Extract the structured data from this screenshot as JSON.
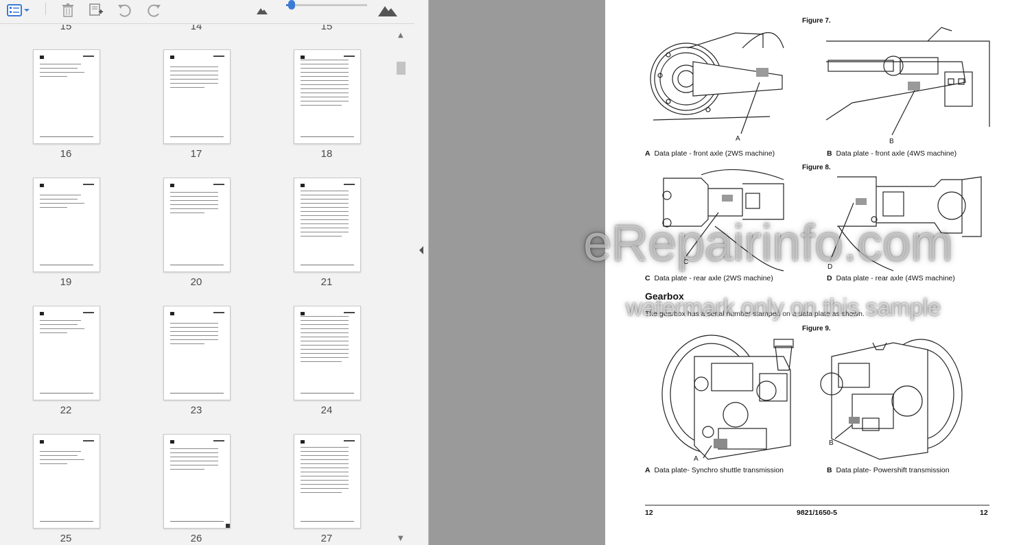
{
  "toolbar": {
    "view_icon": "thumbnail-view-icon",
    "dropdown_icon": "chevron-down-icon",
    "delete_icon": "trash-icon",
    "insert_icon": "insert-page-icon",
    "rotate_ccw_icon": "rotate-counterclockwise-icon",
    "rotate_cw_icon": "rotate-clockwise-icon",
    "zoom_out_icon": "small-mountain-icon",
    "zoom_in_icon": "large-mountain-icon",
    "zoom_level_fraction": 0.07
  },
  "thumbnails": {
    "partial_top": [
      "15",
      "14",
      "15"
    ],
    "pages": [
      "16",
      "17",
      "18",
      "19",
      "20",
      "21",
      "22",
      "23",
      "24",
      "25",
      "26",
      "27"
    ],
    "selected": "26"
  },
  "document": {
    "figure7": {
      "title": "Figure 7.",
      "callout_a": "A",
      "callout_b": "B",
      "caption_a_key": "A",
      "caption_a": "Data plate - front axle (2WS machine)",
      "caption_b_key": "B",
      "caption_b": "Data plate - front axle (4WS machine)"
    },
    "figure8": {
      "title": "Figure 8.",
      "callout_c": "C",
      "callout_d": "D",
      "caption_c_key": "C",
      "caption_c": "Data plate - rear axle (2WS machine)",
      "caption_d_key": "D",
      "caption_d": "Data plate - rear axle (4WS machine)"
    },
    "section_heading": "Gearbox",
    "section_text": "The gearbox has a serial number stamped on a data plate as shown.",
    "figure9": {
      "title": "Figure 9.",
      "callout_a": "A",
      "callout_b": "B",
      "caption_a_key": "A",
      "caption_a": "Data plate- Synchro shuttle transmission",
      "caption_b_key": "B",
      "caption_b": "Data plate- Powershift transmission"
    },
    "footer": {
      "left_page": "12",
      "doc_number": "9821/1650-5",
      "right_page": "12"
    },
    "watermark_main": "eRepairinfo.com",
    "watermark_sub": "watermark only on this sample"
  }
}
